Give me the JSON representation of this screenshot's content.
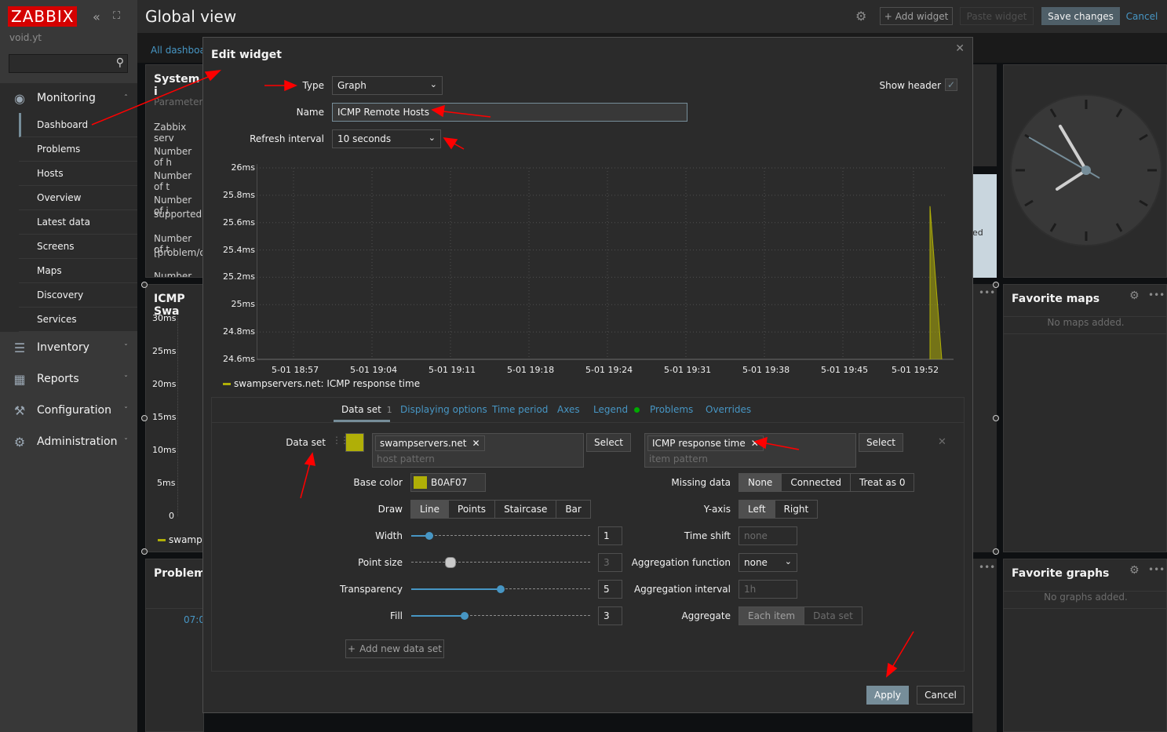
{
  "sidebar": {
    "logo": "ZABBIX",
    "host": "void.yt",
    "collapse_icon": "«",
    "fullscreen_icon": "⛶",
    "search_placeholder": "",
    "monitoring": "Monitoring",
    "monitoring_items": [
      "Dashboard",
      "Problems",
      "Hosts",
      "Overview",
      "Latest data",
      "Screens",
      "Maps",
      "Discovery",
      "Services"
    ],
    "sections": [
      "Inventory",
      "Reports",
      "Configuration",
      "Administration"
    ]
  },
  "topbar": {
    "title": "Global view",
    "add_widget": "Add widget",
    "paste_widget": "Paste widget",
    "save_changes": "Save changes",
    "cancel": "Cancel"
  },
  "background": {
    "all_dashboards": "All dashboar",
    "system_info_title": "System i",
    "system_info_param": "Parameter",
    "system_info_rows": [
      "Zabbix serv",
      "Number of h",
      "Number of t",
      "Number of i",
      "supported)",
      "Number of t",
      "[problem/ok",
      "Number of i"
    ],
    "icmp_title": "ICMP Swa",
    "icmp_yticks": [
      "30ms",
      "25ms",
      "20ms",
      "15ms",
      "10ms",
      "5ms",
      "0"
    ],
    "icmp_legend": "swamps",
    "problems_title": "Problems",
    "problems_time": "07:0",
    "right_edge_text": "ed",
    "favorite_maps_title": "Favorite maps",
    "favorite_maps_empty": "No maps added.",
    "favorite_graphs_title": "Favorite graphs",
    "favorite_graphs_empty": "No graphs added."
  },
  "modal": {
    "title": "Edit widget",
    "type_label": "Type",
    "type_value": "Graph",
    "show_header_label": "Show header",
    "show_header_checked": true,
    "name_label": "Name",
    "name_value": "ICMP Remote Hosts",
    "refresh_label": "Refresh interval",
    "refresh_value": "10 seconds",
    "apply": "Apply",
    "cancel": "Cancel"
  },
  "chart_data": {
    "type": "area",
    "title": "",
    "xlabel": "",
    "ylabel": "",
    "x_ticks": [
      "5-01 18:57",
      "5-01 19:04",
      "5-01 19:11",
      "5-01 19:18",
      "5-01 19:24",
      "5-01 19:31",
      "5-01 19:38",
      "5-01 19:45",
      "5-01 19:52"
    ],
    "y_ticks": [
      "26ms",
      "25.8ms",
      "25.6ms",
      "25.4ms",
      "25.2ms",
      "25ms",
      "24.8ms",
      "24.6ms"
    ],
    "ylim": [
      24.6,
      26
    ],
    "grid": true,
    "series": [
      {
        "name": "swampservers.net: ICMP response time",
        "color": "#B0AF07",
        "x": [
          "5-01 19:54",
          "5-01 19:55"
        ],
        "values": [
          25.72,
          24.6
        ]
      }
    ],
    "legend_placement": "bottom-left"
  },
  "tabs": {
    "items": [
      "Data set",
      "Displaying options",
      "Time period",
      "Axes",
      "Legend",
      "Problems",
      "Overrides"
    ],
    "dataset_count": "1",
    "legend_dot_color": "#00aa00"
  },
  "dataset": {
    "label": "Data set",
    "color": "#B0AF07",
    "host_tag": "swampservers.net",
    "host_placeholder": "host pattern",
    "item_tag": "ICMP response time",
    "item_placeholder": "item pattern",
    "select": "Select",
    "base_color_label": "Base color",
    "base_color_value": "B0AF07",
    "draw_label": "Draw",
    "draw_options": [
      "Line",
      "Points",
      "Staircase",
      "Bar"
    ],
    "draw_selected": "Line",
    "width_label": "Width",
    "width_value": "1",
    "width_level": 0.1,
    "point_size_label": "Point size",
    "point_size_value": "3",
    "point_size_level": 0.22,
    "transparency_label": "Transparency",
    "transparency_value": "5",
    "transparency_level": 0.5,
    "fill_label": "Fill",
    "fill_value": "3",
    "fill_level": 0.3,
    "missing_label": "Missing data",
    "missing_options": [
      "None",
      "Connected",
      "Treat as 0"
    ],
    "missing_selected": "None",
    "yaxis_label": "Y-axis",
    "yaxis_options": [
      "Left",
      "Right"
    ],
    "yaxis_selected": "Left",
    "timeshift_label": "Time shift",
    "timeshift_placeholder": "none",
    "aggfunc_label": "Aggregation function",
    "aggfunc_value": "none",
    "agginterval_label": "Aggregation interval",
    "agginterval_placeholder": "1h",
    "aggregate_label": "Aggregate",
    "aggregate_options": [
      "Each item",
      "Data set"
    ],
    "aggregate_selected": "Each item",
    "add_dataset": "Add new data set"
  },
  "colors": {
    "accent": "#768d99",
    "link": "#4796c4",
    "logo": "#d40000",
    "annotation_arrow": "#ff0000"
  }
}
